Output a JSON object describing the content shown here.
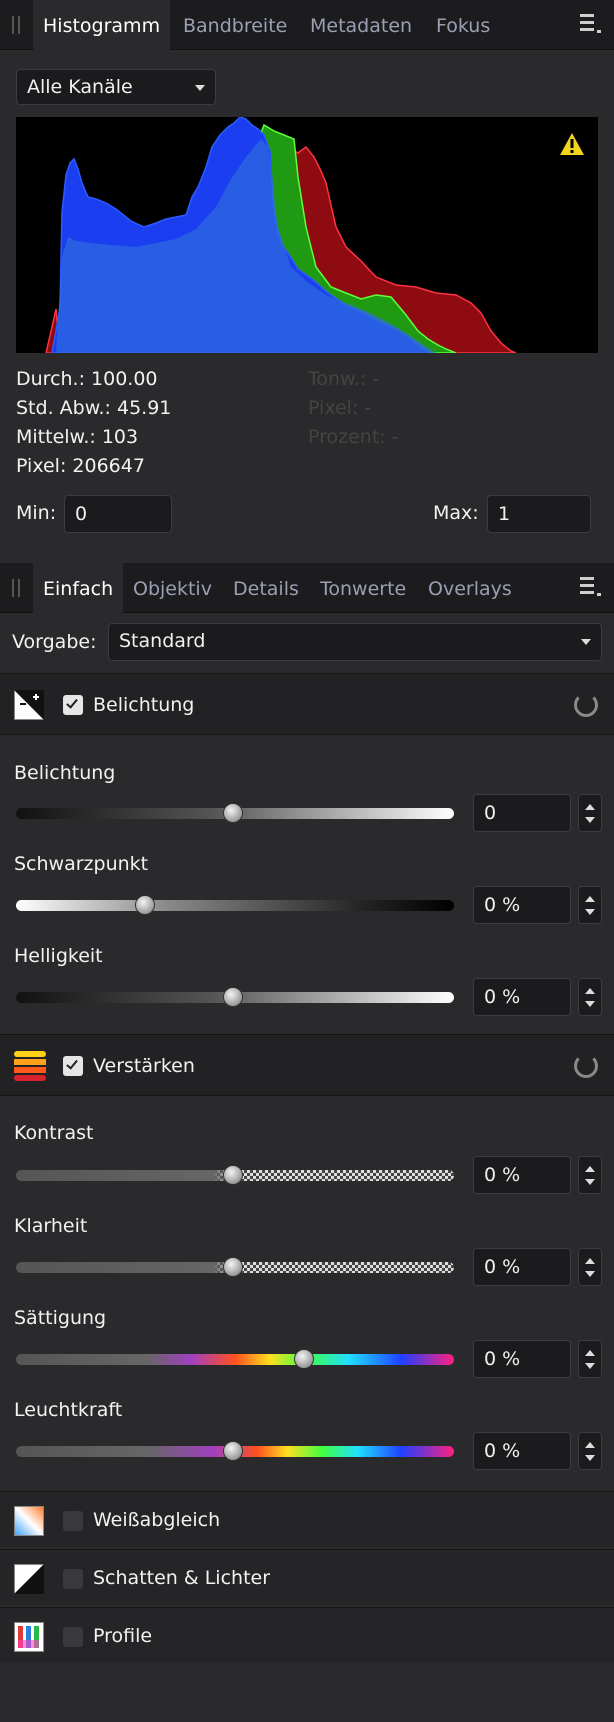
{
  "histogram_panel": {
    "tabs": [
      "Histogramm",
      "Bandbreite",
      "Metadaten",
      "Fokus"
    ],
    "channel": "Alle Kanäle",
    "stats_left": [
      "Durch.: 100.00",
      "Std. Abw.: 45.91",
      "Mittelw.: 103",
      "Pixel: 206647"
    ],
    "stats_right": [
      "Tonw.: -",
      "Pixel: -",
      "Prozent: -"
    ],
    "min_label": "Min:",
    "min_value": "0",
    "max_label": "Max:",
    "max_value": "1"
  },
  "develop_panel": {
    "tabs": [
      "Einfach",
      "Objektiv",
      "Details",
      "Tonwerte",
      "Overlays"
    ],
    "preset_label": "Vorgabe:",
    "preset_value": "Standard",
    "sections": {
      "exposure": {
        "title": "Belichtung",
        "enabled": true,
        "sliders": [
          {
            "label": "Belichtung",
            "value": "0",
            "position": 0.45
          },
          {
            "label": "Schwarzpunkt",
            "value": "0 %",
            "position": 0.27
          },
          {
            "label": "Helligkeit",
            "value": "0 %",
            "position": 0.45
          }
        ]
      },
      "enhance": {
        "title": "Verstärken",
        "enabled": true,
        "sliders": [
          {
            "label": "Kontrast",
            "value": "0 %",
            "position": 0.45
          },
          {
            "label": "Klarheit",
            "value": "0 %",
            "position": 0.45
          },
          {
            "label": "Sättigung",
            "value": "0 %",
            "position": 0.61
          },
          {
            "label": "Leuchtkraft",
            "value": "0 %",
            "position": 0.45
          }
        ]
      },
      "white_balance": {
        "title": "Weißabgleich",
        "enabled": false
      },
      "shadows_highlights": {
        "title": "Schatten & Lichter",
        "enabled": false
      },
      "profiles": {
        "title": "Profile",
        "enabled": false
      }
    }
  }
}
